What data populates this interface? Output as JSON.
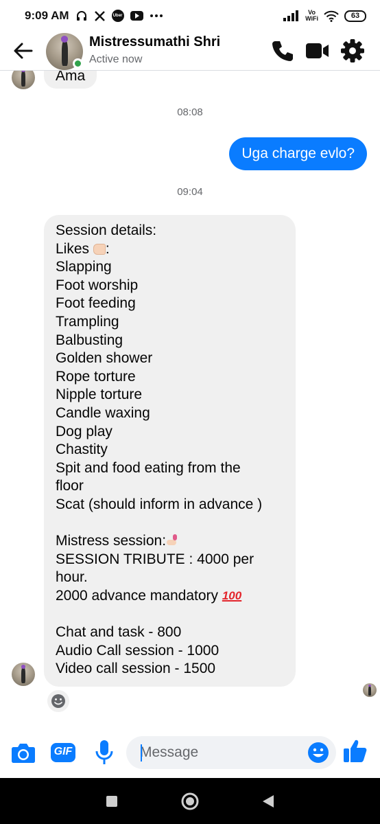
{
  "status_bar": {
    "time": "9:09 AM",
    "notification_icons": [
      "headphones-icon",
      "x-icon",
      "uber-icon",
      "youtube-icon",
      "more-dots-icon"
    ],
    "vowifi_label": "Vo\nWiFi",
    "battery": "63"
  },
  "header": {
    "contact_name": "Mistressumathi Shri",
    "contact_status": "Active now",
    "icons": [
      "back-arrow-icon",
      "phone-icon",
      "video-camera-icon",
      "gear-icon"
    ]
  },
  "chat": {
    "previous_message": "Ama",
    "timestamps": [
      "08:08",
      "09:04"
    ],
    "outgoing_message": "Uga charge evlo?",
    "incoming_lines": [
      "Session details:",
      "Likes",
      "Slapping",
      "Foot worship",
      "Foot feeding",
      "Trampling",
      "Balbusting",
      "Golden shower",
      "Rope torture",
      "Nipple torture",
      "Candle waxing",
      "Dog play",
      "Chastity",
      "Spit and food eating from the",
      "floor",
      "Scat (should inform in advance )",
      "",
      "Mistress session:",
      "SESSION TRIBUTE : 4000 per",
      "hour.",
      "2000 advance mandatory",
      "",
      "Chat and task - 800",
      "Audio Call session - 1000",
      "Video call session - 1500"
    ],
    "likes_suffix": ":",
    "emoji_hundred": "100"
  },
  "composer": {
    "placeholder": "Message",
    "gif_label": "GIF"
  },
  "colors": {
    "accent": "#0a7cff",
    "incoming_bubble": "#f0f0f0",
    "online": "#31a24c",
    "secondary_text": "#65676b"
  }
}
